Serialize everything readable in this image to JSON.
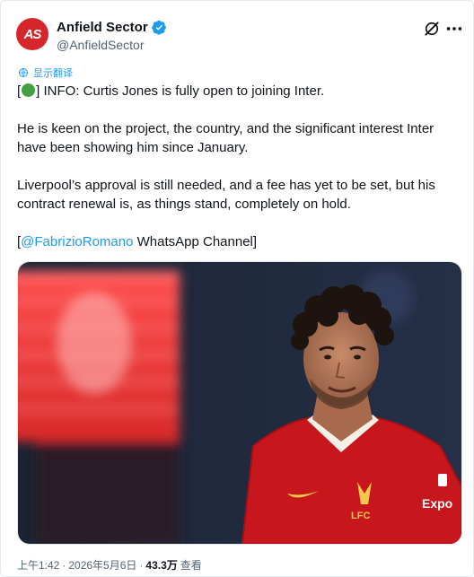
{
  "author": {
    "display_name": "Anfield Sector",
    "handle": "@AnfieldSector",
    "avatar_text": "AS",
    "verified": true
  },
  "translate_label": "显示翻译",
  "tweet": {
    "line1_prefix": "[",
    "line1_emoji": "green-circle",
    "line1_text": "] INFO: Curtis Jones is fully open to joining Inter.",
    "para2": "He is keen on the project, the country, and the significant interest Inter have been showing him since January.",
    "para3": "Liverpool’s approval is still needed, and a fee has yet to be set, but his contract renewal is, as things stand, completely on hold.",
    "source_open": "[",
    "source_mention": "@FabrizioRomano",
    "source_rest": " WhatsApp Channel]"
  },
  "media": {
    "description": "photo",
    "sponsor": "Expo",
    "crest_text": "LFC"
  },
  "meta": {
    "time": "上午1:42",
    "date": "2026年5月6日",
    "views": "43.3万",
    "views_label": "查看",
    "separator": "·"
  },
  "colors": {
    "accent": "#1d9bf0",
    "text": "#0f1419",
    "muted": "#536471",
    "avatar_bg": "#d6262b"
  }
}
